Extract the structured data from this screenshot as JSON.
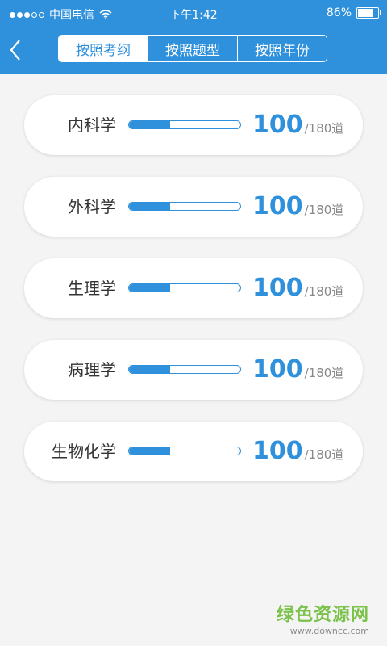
{
  "status_bar": {
    "carrier": "中国电信",
    "time": "下午1:42",
    "battery": "86%",
    "battery_level": 0.86
  },
  "nav": {
    "back_icon": "chevron-left-icon",
    "tabs": [
      {
        "label": "按照考纲",
        "active": true
      },
      {
        "label": "按照题型",
        "active": false
      },
      {
        "label": "按照年份",
        "active": false
      }
    ]
  },
  "subjects": [
    {
      "name": "内科学",
      "done": "100",
      "total": "/180道",
      "progress": 0.37
    },
    {
      "name": "外科学",
      "done": "100",
      "total": "/180道",
      "progress": 0.37
    },
    {
      "name": "生理学",
      "done": "100",
      "total": "/180道",
      "progress": 0.37
    },
    {
      "name": "病理学",
      "done": "100",
      "total": "/180道",
      "progress": 0.37
    },
    {
      "name": "生物化学",
      "done": "100",
      "total": "/180道",
      "progress": 0.37
    }
  ],
  "watermark": {
    "title": "绿色资源网",
    "url": "www.downcc.com"
  },
  "colors": {
    "primary": "#2f90dc",
    "background": "#f4f4f4",
    "watermark": "#7bc24a"
  }
}
